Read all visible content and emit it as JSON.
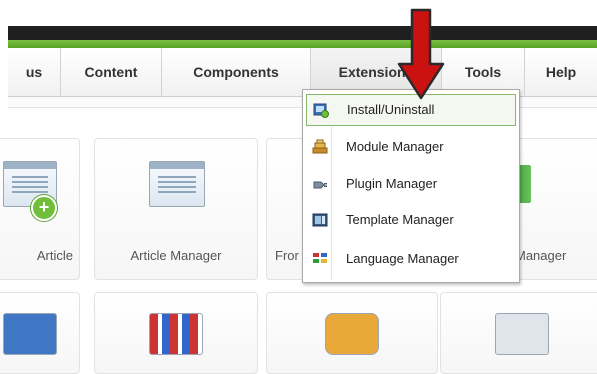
{
  "menu": {
    "items": [
      {
        "key": "menus",
        "label": "us"
      },
      {
        "key": "content",
        "label": "Content"
      },
      {
        "key": "components",
        "label": "Components"
      },
      {
        "key": "extensions",
        "label": "Extensions"
      },
      {
        "key": "tools",
        "label": "Tools"
      },
      {
        "key": "help",
        "label": "Help"
      }
    ],
    "active": "Extensions"
  },
  "dropdown": {
    "items": [
      {
        "label": "Install/Uninstall",
        "icon": "install-icon"
      },
      {
        "label": "Module Manager",
        "icon": "module-icon"
      },
      {
        "label": "Plugin Manager",
        "icon": "plugin-icon"
      },
      {
        "label": "Template Manager",
        "icon": "template-icon"
      },
      {
        "label": "Language Manager",
        "icon": "language-icon"
      }
    ]
  },
  "tiles": {
    "row1": [
      {
        "label": "Article",
        "icon": "add-article-icon"
      },
      {
        "label": "Article Manager",
        "icon": "article-manager-icon"
      },
      {
        "label": "Fror",
        "icon": "frontpage-icon"
      },
      {
        "label": "Manager",
        "icon": "section-manager-icon"
      }
    ]
  },
  "annotation": {
    "arrow_color": "#cc1111",
    "label": "pointer-arrow"
  },
  "colors": {
    "accent_green": "#6fbf3a",
    "highlight_border": "#8ab66b"
  }
}
